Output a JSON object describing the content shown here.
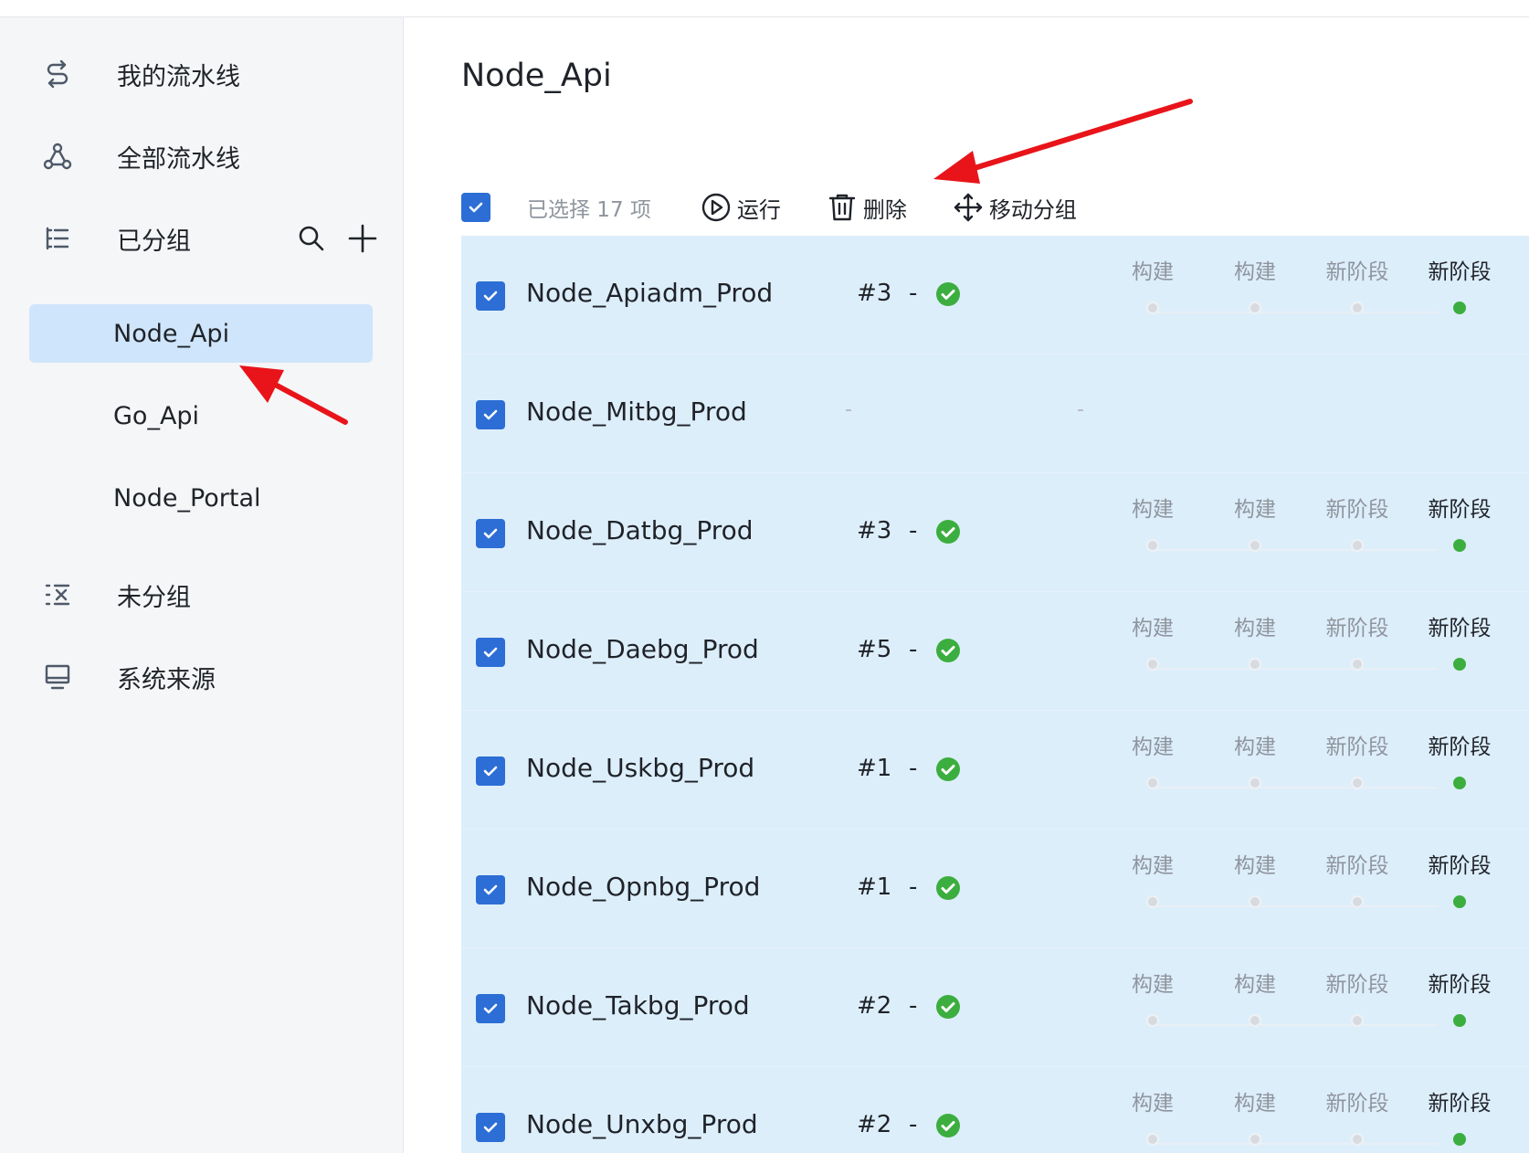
{
  "sidebar": {
    "nav": [
      {
        "label": "我的流水线",
        "icon": "pipeline-switch-icon"
      },
      {
        "label": "全部流水线",
        "icon": "pipeline-graph-icon"
      },
      {
        "label": "已分组",
        "icon": "grouped-list-icon"
      },
      {
        "label": "未分组",
        "icon": "ungrouped-list-icon"
      },
      {
        "label": "系统来源",
        "icon": "monitor-icon"
      }
    ],
    "groups": [
      {
        "label": "Node_Api",
        "active": true
      },
      {
        "label": "Go_Api",
        "active": false
      },
      {
        "label": "Node_Portal",
        "active": false
      }
    ]
  },
  "main": {
    "title": "Node_Api",
    "toolbar": {
      "selected": "已选择 17 项",
      "run": "运行",
      "delete": "删除",
      "move": "移动分组"
    },
    "stage_labels": [
      "构建",
      "构建",
      "新阶段",
      "新阶段"
    ],
    "rows": [
      {
        "name": "Node_Apiadm_Prod",
        "run": "#3",
        "sep": "-",
        "status": "success",
        "stages": true
      },
      {
        "name": "Node_Mitbg_Prod",
        "run": "",
        "sep": "",
        "status": "none",
        "stages": false,
        "dash1": "-",
        "dash2": "-"
      },
      {
        "name": "Node_Datbg_Prod",
        "run": "#3",
        "sep": "-",
        "status": "success",
        "stages": true
      },
      {
        "name": "Node_Daebg_Prod",
        "run": "#5",
        "sep": "-",
        "status": "success",
        "stages": true
      },
      {
        "name": "Node_Uskbg_Prod",
        "run": "#1",
        "sep": "-",
        "status": "success",
        "stages": true
      },
      {
        "name": "Node_Opnbg_Prod",
        "run": "#1",
        "sep": "-",
        "status": "success",
        "stages": true
      },
      {
        "name": "Node_Takbg_Prod",
        "run": "#2",
        "sep": "-",
        "status": "success",
        "stages": true
      },
      {
        "name": "Node_Unxbg_Prod",
        "run": "#2",
        "sep": "-",
        "status": "success",
        "stages": true
      }
    ]
  },
  "colors": {
    "accent": "#2c6ed5",
    "active_group_bg": "#cfe5fb",
    "row_bg": "#ddeefb",
    "success": "#3cae3f",
    "annotation_arrow": "#e8141a"
  }
}
